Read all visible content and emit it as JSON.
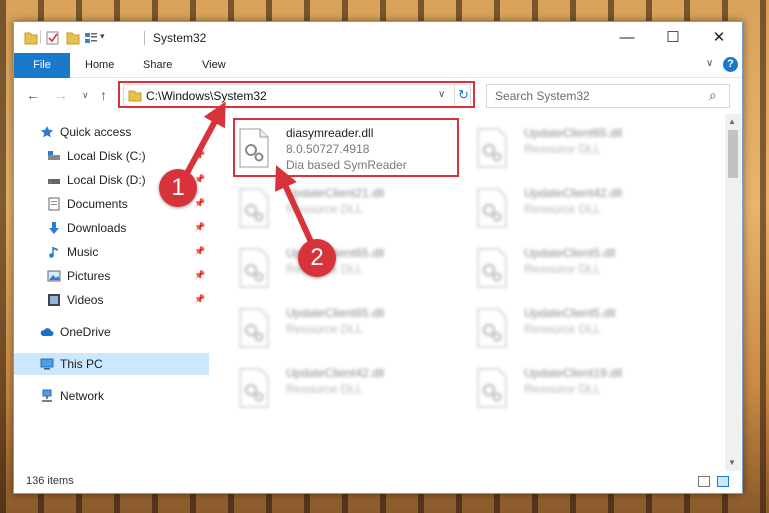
{
  "window": {
    "title": "System32",
    "controls": {
      "minimize": "—",
      "maximize": "☐",
      "close": "✕"
    }
  },
  "ribbon": {
    "tabs": [
      "File",
      "Home",
      "Share",
      "View"
    ],
    "expand_glyph": "∨",
    "help_glyph": "?"
  },
  "nav": {
    "back": "←",
    "forward": "→",
    "recent": "∨",
    "up": "↑",
    "address": "C:\\Windows\\System32",
    "address_dropdown": "∨",
    "refresh": "↻",
    "search_placeholder": "Search System32",
    "search_glyph": "⌕"
  },
  "sidebar": {
    "items": [
      {
        "label": "Quick access",
        "icon": "star-icon",
        "pinned": false
      },
      {
        "label": "Local Disk (C:)",
        "icon": "drive-icon",
        "pinned": true
      },
      {
        "label": "Local Disk (D:)",
        "icon": "drive-icon",
        "pinned": true
      },
      {
        "label": "Documents",
        "icon": "documents-icon",
        "pinned": true
      },
      {
        "label": "Downloads",
        "icon": "download-icon",
        "pinned": true
      },
      {
        "label": "Music",
        "icon": "music-icon",
        "pinned": true
      },
      {
        "label": "Pictures",
        "icon": "pictures-icon",
        "pinned": true
      },
      {
        "label": "Videos",
        "icon": "videos-icon",
        "pinned": true
      },
      {
        "label": "OneDrive",
        "icon": "cloud-icon",
        "pinned": false
      },
      {
        "label": "This PC",
        "icon": "computer-icon",
        "pinned": false,
        "selected": true
      },
      {
        "label": "Network",
        "icon": "network-icon",
        "pinned": false
      }
    ],
    "pin_glyph": "📌"
  },
  "files": [
    {
      "name": "diasymreader.dll",
      "line2": "8.0.50727.4918",
      "line3": "Dia based SymReader",
      "highlighted": true
    },
    {
      "name": "UpdateClient65.dll",
      "line2": "Resource DLL"
    },
    {
      "name": "UpdateClient21.dll",
      "line2": "Resource DLL"
    },
    {
      "name": "UpdateClient42.dll",
      "line2": "Resource DLL"
    },
    {
      "name": "UpdateClient65.dll",
      "line2": "Resource DLL"
    },
    {
      "name": "UpdateClient5.dll",
      "line2": "Resource DLL"
    },
    {
      "name": "UpdateClient65.dll",
      "line2": "Resource DLL"
    },
    {
      "name": "UpdateClient5.dll",
      "line2": "Resource DLL"
    },
    {
      "name": "UpdateClient42.dll",
      "line2": "Resource DLL"
    },
    {
      "name": "UpdateClient19.dll",
      "line2": "Resource DLL"
    }
  ],
  "status": {
    "item_count": "136 items"
  },
  "callouts": [
    "1",
    "2"
  ],
  "colors": {
    "accent": "#1979ca",
    "annotation_red": "#d8333a",
    "selection": "#cce8ff"
  }
}
